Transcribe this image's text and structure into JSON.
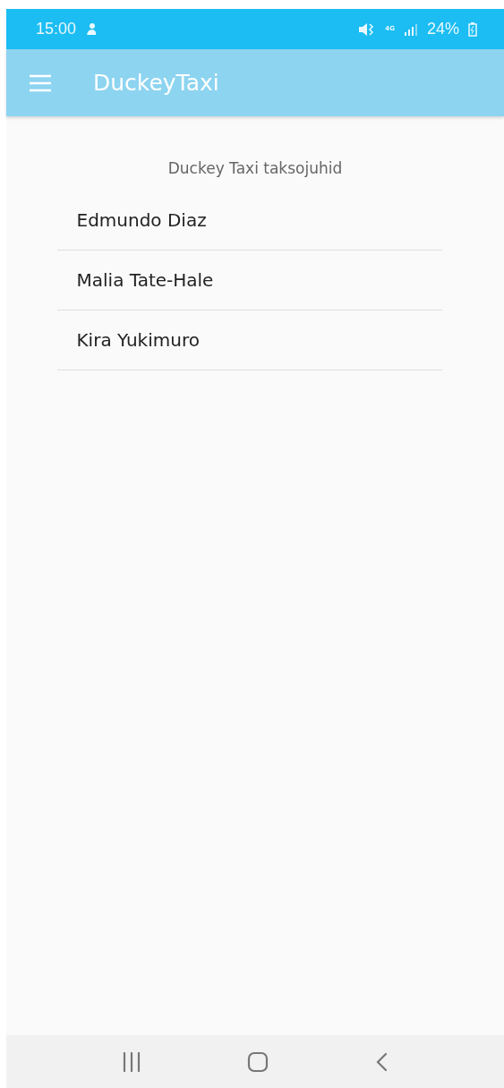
{
  "status_bar": {
    "time": "15:00",
    "network": "4G",
    "battery": "24%"
  },
  "app_bar": {
    "title": "DuckeyTaxi"
  },
  "heading": "Duckey Taxi taksojuhid",
  "drivers": [
    {
      "name": "Edmundo Diaz"
    },
    {
      "name": "Malia Tate-Hale"
    },
    {
      "name": "Kira Yukimuro"
    }
  ]
}
